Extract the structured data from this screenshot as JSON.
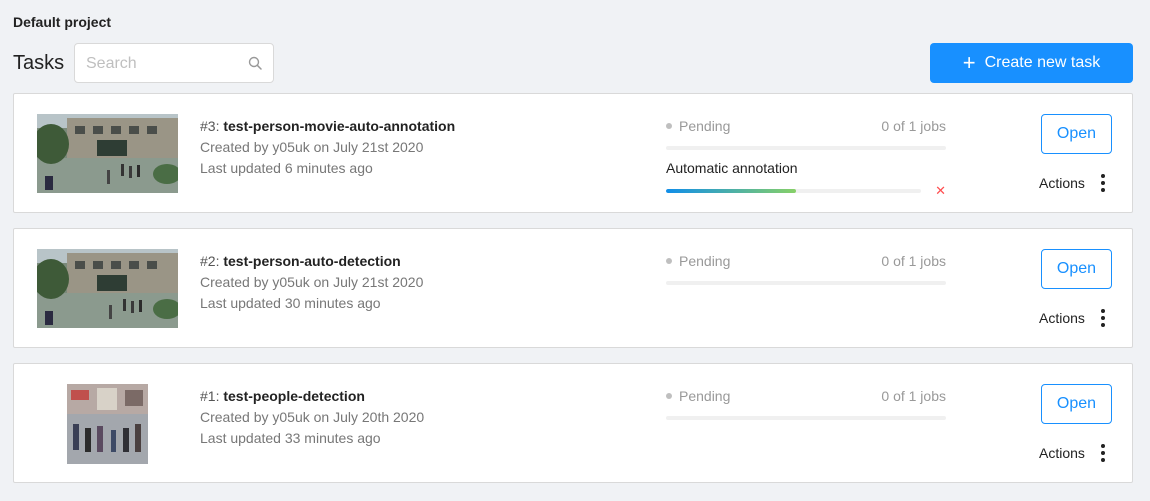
{
  "project": {
    "title": "Default project"
  },
  "header": {
    "title": "Tasks",
    "search_placeholder": "Search",
    "create_label": "Create new task"
  },
  "colors": {
    "accent": "#1890ff",
    "background": "#f0f2f5"
  },
  "tasks": [
    {
      "id_label": "#3:",
      "name": "test-person-movie-auto-annotation",
      "created": "Created by y05uk on July 21st 2020",
      "updated": "Last updated 6 minutes ago",
      "status": "Pending",
      "jobs": "0 of 1 jobs",
      "jobs_progress": 0,
      "auto_annotation_label": "Automatic annotation",
      "auto_annotation_progress": 0.51,
      "open_label": "Open",
      "actions_label": "Actions"
    },
    {
      "id_label": "#2:",
      "name": "test-person-auto-detection",
      "created": "Created by y05uk on July 21st 2020",
      "updated": "Last updated 30 minutes ago",
      "status": "Pending",
      "jobs": "0 of 1 jobs",
      "jobs_progress": 0,
      "open_label": "Open",
      "actions_label": "Actions"
    },
    {
      "id_label": "#1:",
      "name": "test-people-detection",
      "created": "Created by y05uk on July 20th 2020",
      "updated": "Last updated 33 minutes ago",
      "status": "Pending",
      "jobs": "0 of 1 jobs",
      "jobs_progress": 0,
      "open_label": "Open",
      "actions_label": "Actions"
    }
  ]
}
